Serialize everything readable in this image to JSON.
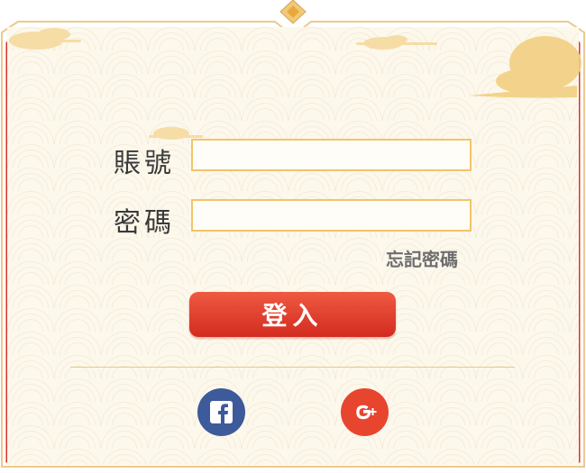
{
  "form": {
    "account_label": "賬號",
    "password_label": "密碼",
    "forgot_label": "忘記密碼",
    "login_label": "登入"
  },
  "social": {
    "facebook_icon": "facebook-icon",
    "google_plus_icon": "google-plus-icon"
  },
  "colors": {
    "frame_red": "#d9342b",
    "frame_gold": "#e9c27a",
    "panel_bg": "#fdf8ec",
    "input_border": "#f2c46a",
    "login_button": "#e0392a",
    "facebook": "#3d5a9a",
    "google_plus": "#e8452f"
  }
}
